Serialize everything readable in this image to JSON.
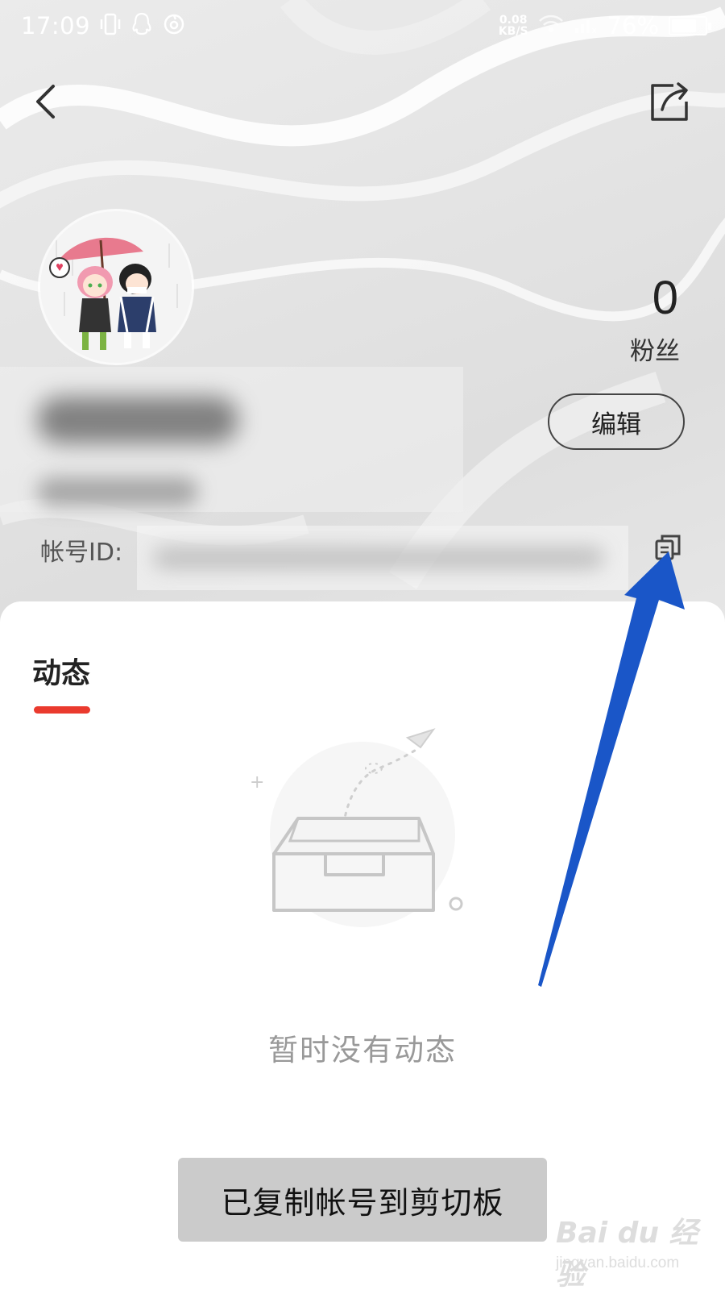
{
  "status_bar": {
    "time": "17:09",
    "speed_value": "0.08",
    "speed_unit": "KB/S",
    "battery_percent": "76%",
    "battery_level": 0.76,
    "icons": [
      "vibrate-icon",
      "qq-icon",
      "netease-music-icon",
      "wifi-icon",
      "signal-icon",
      "battery-icon"
    ]
  },
  "nav": {
    "back_icon": "chevron-left-icon",
    "share_icon": "share-icon"
  },
  "profile": {
    "followers_count": "0",
    "followers_label": "粉丝",
    "edit_label": "编辑",
    "account_id_label": "帐号ID:",
    "copy_icon": "copy-icon"
  },
  "tabs": [
    {
      "label": "动态",
      "active": true
    }
  ],
  "empty_state": {
    "text": "暂时没有动态"
  },
  "toast": {
    "text": "已复制帐号到剪切板"
  },
  "watermark": {
    "brand": "Bai du 经验",
    "url": "jingyan.baidu.com"
  },
  "colors": {
    "tab_indicator": "#ea3a2e",
    "annotation_arrow": "#1a56c8",
    "toast_bg": "#cbcbcb"
  }
}
